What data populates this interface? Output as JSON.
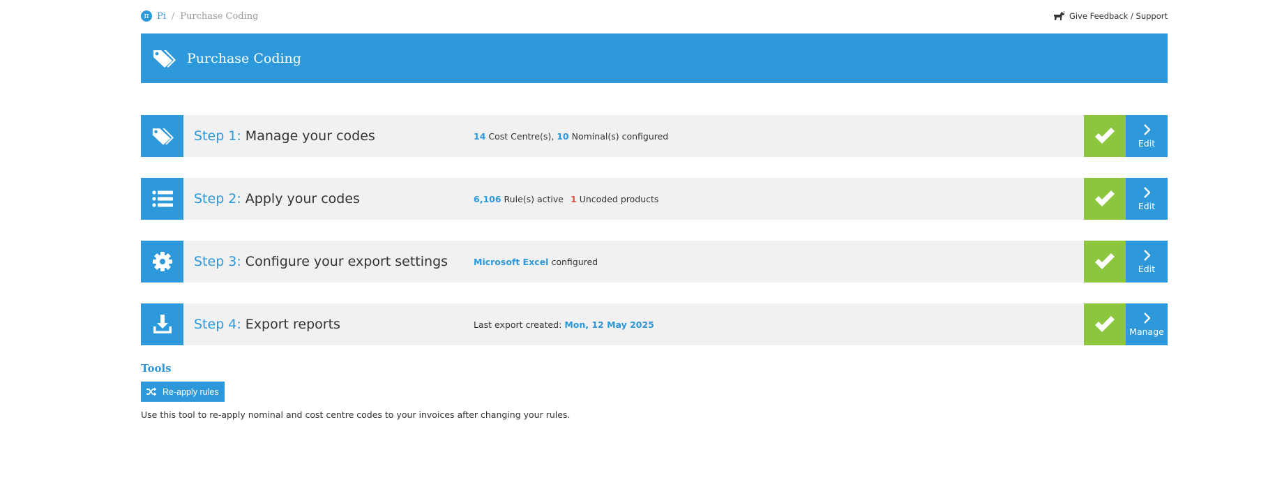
{
  "breadcrumb": {
    "home_icon": "pi-logo-icon",
    "home_label": "Pi",
    "separator": "/",
    "current": "Purchase Coding"
  },
  "feedback": {
    "icon": "dog-icon",
    "label": "Give Feedback / Support"
  },
  "header": {
    "icon": "tags-icon",
    "title": "Purchase Coding"
  },
  "steps": [
    {
      "icon": "tags-icon",
      "number": "Step 1:",
      "title": "Manage your codes",
      "summary": {
        "count1": "14",
        "text1": "Cost Centre(s),",
        "count2": "10",
        "text2": "Nominal(s) configured"
      },
      "status": "check-icon",
      "action": "Edit"
    },
    {
      "icon": "list-icon",
      "number": "Step 2:",
      "title": "Apply your codes",
      "summary": {
        "count1": "6,106",
        "text1": "Rule(s) active",
        "count2": "1",
        "text2": "Uncoded products"
      },
      "status": "check-icon",
      "action": "Edit"
    },
    {
      "icon": "gear-icon",
      "number": "Step 3:",
      "title": "Configure your export settings",
      "summary": {
        "highlight": "Microsoft Excel",
        "text": "configured"
      },
      "status": "check-icon",
      "action": "Edit"
    },
    {
      "icon": "download-icon",
      "number": "Step 4:",
      "title": "Export reports",
      "summary": {
        "text": "Last export created:",
        "highlight": "Mon, 12 May 2025"
      },
      "status": "check-icon",
      "action": "Manage"
    }
  ],
  "tools": {
    "heading": "Tools",
    "button_icon": "shuffle-icon",
    "button_label": "Re-apply rules",
    "description": "Use this tool to re-apply nominal and cost centre codes to your invoices after changing your rules."
  },
  "colors": {
    "primary": "#2d98da",
    "success": "#8cc63f",
    "warning_text": "#e74c3c",
    "row_bg": "#f1f1f1"
  }
}
